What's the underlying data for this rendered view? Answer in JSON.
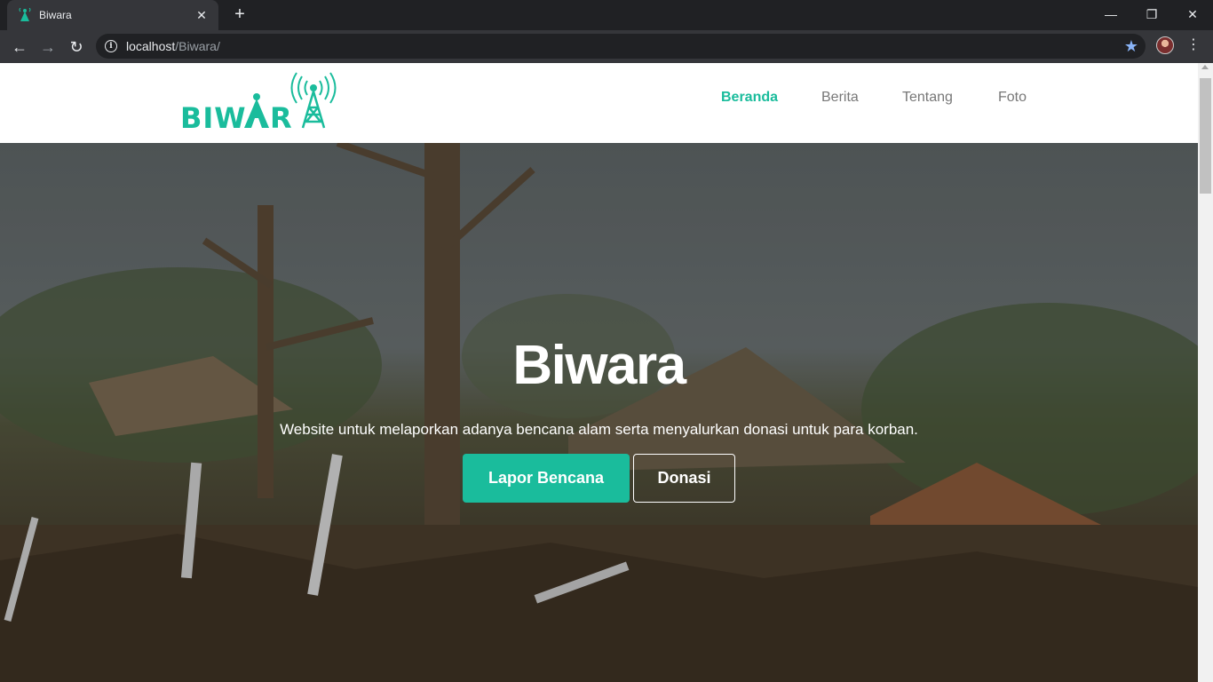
{
  "browser": {
    "tab_title": "Biwara",
    "url_host": "localhost",
    "url_path": "/Biwara/",
    "new_tab_label": "+",
    "close_tab_label": "✕",
    "back_label": "←",
    "forward_label": "→",
    "reload_label": "↻",
    "minimize_label": "—",
    "restore_label": "❐",
    "close_window_label": "✕",
    "menu_label": "⋮",
    "star_label": "★"
  },
  "site": {
    "logo_text": "BIWARA",
    "brand_color": "#1abc9c",
    "nav": [
      {
        "label": "Beranda",
        "active": true
      },
      {
        "label": "Berita",
        "active": false
      },
      {
        "label": "Tentang",
        "active": false
      },
      {
        "label": "Foto",
        "active": false
      }
    ]
  },
  "hero": {
    "title": "Biwara",
    "subtitle": "Website untuk melaporkan adanya bencana alam serta menyalurkan donasi untuk para korban.",
    "primary_button": "Lapor Bencana",
    "secondary_button": "Donasi"
  }
}
